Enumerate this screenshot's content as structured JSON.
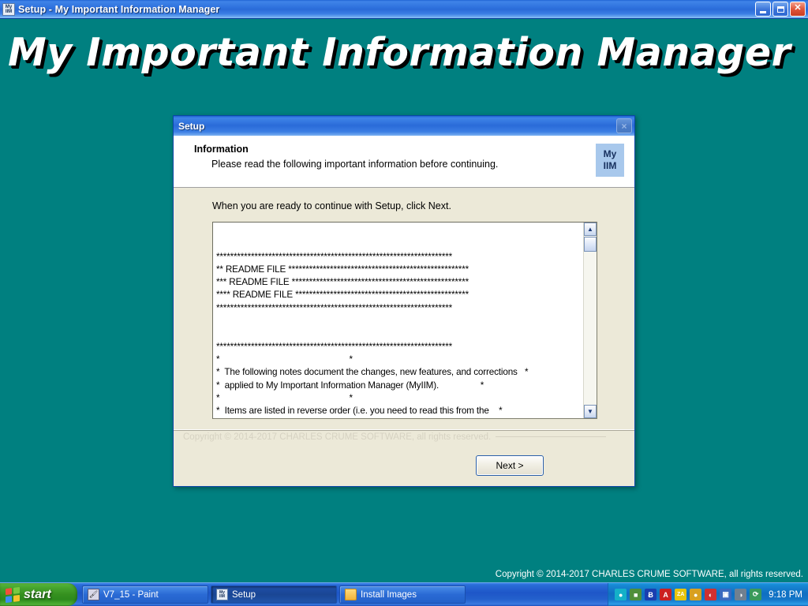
{
  "window": {
    "title": "Setup - My Important Information Manager",
    "icon": "myiim-icon",
    "icon_line1": "My",
    "icon_line2": "IIM",
    "minimize_label": "Minimize",
    "restore_label": "Restore",
    "close_label": "Close"
  },
  "desktop": {
    "banner": "My Important Information Manager",
    "copyright": "Copyright © 2014-2017 CHARLES CRUME SOFTWARE, all rights reserved.",
    "background_color": "#008080"
  },
  "dialog": {
    "title": "Setup",
    "close_label": "×",
    "header": {
      "title": "Information",
      "subtitle": "Please read the following important information before continuing.",
      "logo_line1": "My",
      "logo_line2": "IIM",
      "logo_color": "#a8c8ec"
    },
    "ready_line": "When you are ready to continue with Setup, click Next.",
    "readme_text": "\n\n********************************************************************\n** README FILE ****************************************************\n*** README FILE ***************************************************\n**** README FILE **************************************************\n********************************************************************\n\n\n********************************************************************\n*                                                     *\n*  The following notes document the changes, new features, and corrections   *\n*  applied to My Important Information Manager (MyIIM).                 *\n*                                                     *\n*  Items are listed in reverse order (i.e. you need to read this from the    *\n*  the bottom up)                                          *",
    "scrollbar": {
      "up_arrow": "▲",
      "down_arrow": "▼"
    },
    "footer_copyright": "Copyright © 2014-2017 CHARLES CRUME SOFTWARE, all rights reserved.",
    "next_button": "Next >",
    "next_accel": "N"
  },
  "taskbar": {
    "start_label": "start",
    "tasks": [
      {
        "label": "V7_15 - Paint",
        "icon": "paint-icon",
        "active": false
      },
      {
        "label": "Setup",
        "icon": "setup-icon",
        "active": true
      },
      {
        "label": "Install Images",
        "icon": "folder-icon",
        "active": false
      }
    ],
    "tray_icons": [
      {
        "name": "network-icon",
        "glyph": "●",
        "color": "#14b0c8"
      },
      {
        "name": "display-icon",
        "glyph": "■",
        "color": "#4f8f3a"
      },
      {
        "name": "bluetooth-icon",
        "glyph": "Ƀ",
        "color": "#1a3fb0"
      },
      {
        "name": "antivirus-icon",
        "glyph": "A",
        "color": "#cc2020"
      },
      {
        "name": "zonealarm-icon",
        "glyph": "ZA",
        "color": "#e8c40c"
      },
      {
        "name": "update-icon",
        "glyph": "●",
        "color": "#d8a020"
      },
      {
        "name": "shield-icon",
        "glyph": "◐",
        "color": "#d03030"
      },
      {
        "name": "network-connections-icon",
        "glyph": "▣",
        "color": "#3a6ac0"
      },
      {
        "name": "volume-icon",
        "glyph": "◑",
        "color": "#708090"
      },
      {
        "name": "sync-icon",
        "glyph": "⟳",
        "color": "#3a9a5a"
      }
    ],
    "clock": "9:18 PM"
  }
}
